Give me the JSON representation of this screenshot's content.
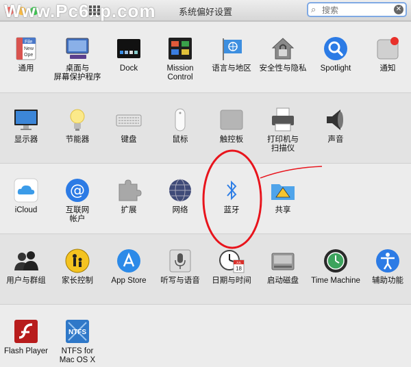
{
  "window": {
    "title": "系统偏好设置",
    "watermark": "Www.Pc6xp.com"
  },
  "search": {
    "placeholder": "搜索",
    "value": ""
  },
  "sections": [
    {
      "items": [
        {
          "label": "通用"
        },
        {
          "label": "桌面与\n屏幕保护程序"
        },
        {
          "label": "Dock"
        },
        {
          "label": "Mission\nControl"
        },
        {
          "label": "语言与地区"
        },
        {
          "label": "安全性与隐私"
        },
        {
          "label": "Spotlight"
        },
        {
          "label": "通知"
        }
      ]
    },
    {
      "items": [
        {
          "label": "显示器"
        },
        {
          "label": "节能器"
        },
        {
          "label": "键盘"
        },
        {
          "label": "鼠标"
        },
        {
          "label": "触控板"
        },
        {
          "label": "打印机与\n扫描仪"
        },
        {
          "label": "声音"
        }
      ]
    },
    {
      "items": [
        {
          "label": "iCloud"
        },
        {
          "label": "互联网\n帐户"
        },
        {
          "label": "扩展"
        },
        {
          "label": "网络"
        },
        {
          "label": "蓝牙"
        },
        {
          "label": "共享"
        }
      ]
    },
    {
      "items": [
        {
          "label": "用户与群组"
        },
        {
          "label": "家长控制"
        },
        {
          "label": "App Store"
        },
        {
          "label": "听写与语音"
        },
        {
          "label": "日期与时间"
        },
        {
          "label": "启动磁盘"
        },
        {
          "label": "Time Machine"
        },
        {
          "label": "辅助功能"
        }
      ]
    },
    {
      "items": [
        {
          "label": "Flash Player"
        },
        {
          "label": "NTFS for\nMac OS X"
        }
      ]
    }
  ],
  "icon_text": {
    "general_file": "File",
    "general_new": "New",
    "general_open": "Ope",
    "calendar_month": "JUL",
    "calendar_day": "18",
    "ntfs": "NTFS"
  },
  "colors": {
    "annotation": "#e8141c",
    "search_focus": "#7fa9e4"
  }
}
